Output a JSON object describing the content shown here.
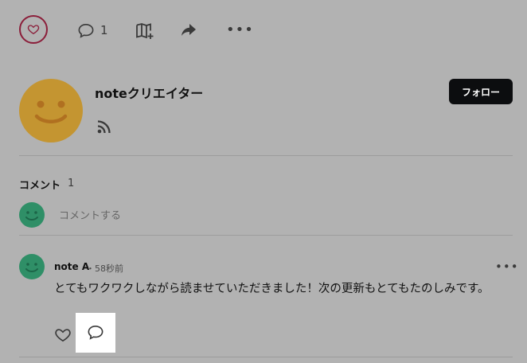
{
  "toolbar": {
    "like_icon": "heart-icon",
    "comment_icon": "comment-bubble-icon",
    "comment_count": "1",
    "magazine_icon": "add-to-magazine-icon",
    "share_icon": "share-arrow-icon",
    "more_icon": "more-horizontal-icon"
  },
  "creator": {
    "name": "noteクリエイター",
    "follow_label": "フォロー",
    "rss_icon": "rss-icon",
    "avatar_color": "#c49531"
  },
  "comments": {
    "title": "コメント",
    "count": "1",
    "input_placeholder": "コメントする",
    "avatar_color": "#2f8f67",
    "items": [
      {
        "author": "note A",
        "meta": "・58秒前",
        "text": "とてもワクワクしながら読ませていただきました！次の更新もとてもたのしみです。",
        "more_label": "•••"
      }
    ]
  },
  "colors": {
    "background": "#b2b2b2",
    "accent_like": "#8b1e3a",
    "follow_button": "#0c0d0f"
  }
}
